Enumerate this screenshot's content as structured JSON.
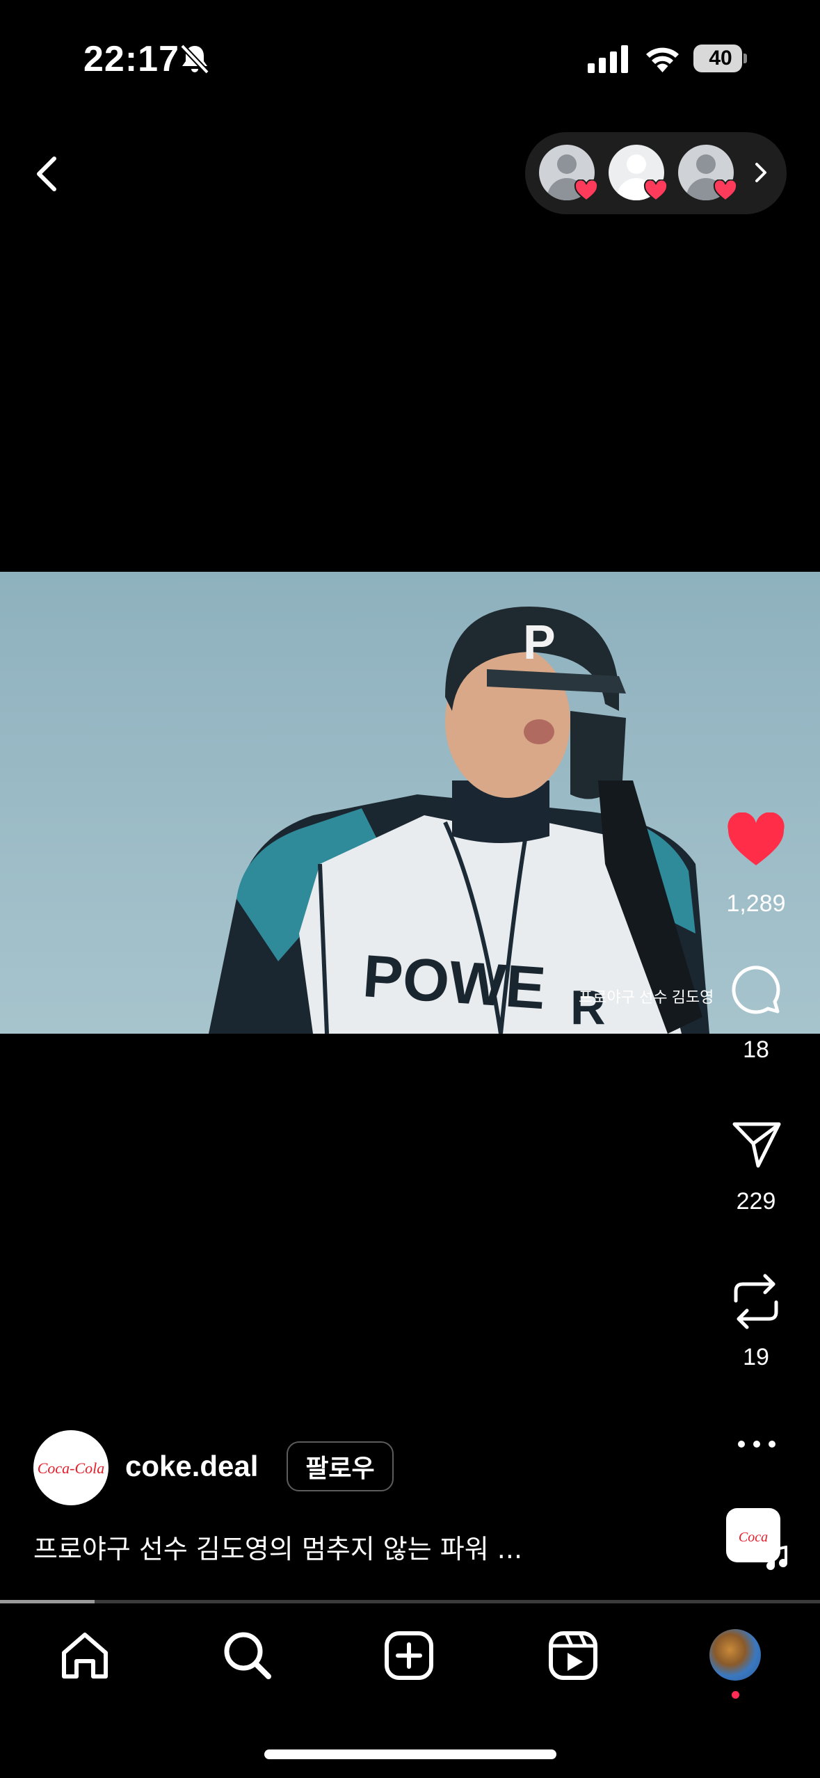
{
  "status_bar": {
    "time": "22:17",
    "battery": "40"
  },
  "likers": {
    "count_shown": 3
  },
  "video": {
    "overlay_caption": "프로야구 선수 김도영"
  },
  "actions": {
    "likes": "1,289",
    "comments": "18",
    "shares": "229",
    "reposts": "19"
  },
  "author": {
    "username": "coke.deal",
    "follow_label": "팔로우",
    "avatar_logo_text": "Coca-Cola"
  },
  "post": {
    "caption": "프로야구 선수 김도영의 멈추지 않는 파워 ..."
  },
  "playback": {
    "progress": 0.115
  },
  "colors": {
    "like_red": "#ff2d47",
    "coke_red": "#e41e2b"
  },
  "tabs": [
    "home-icon",
    "search-icon",
    "create-icon",
    "reels-icon",
    "profile-avatar"
  ]
}
